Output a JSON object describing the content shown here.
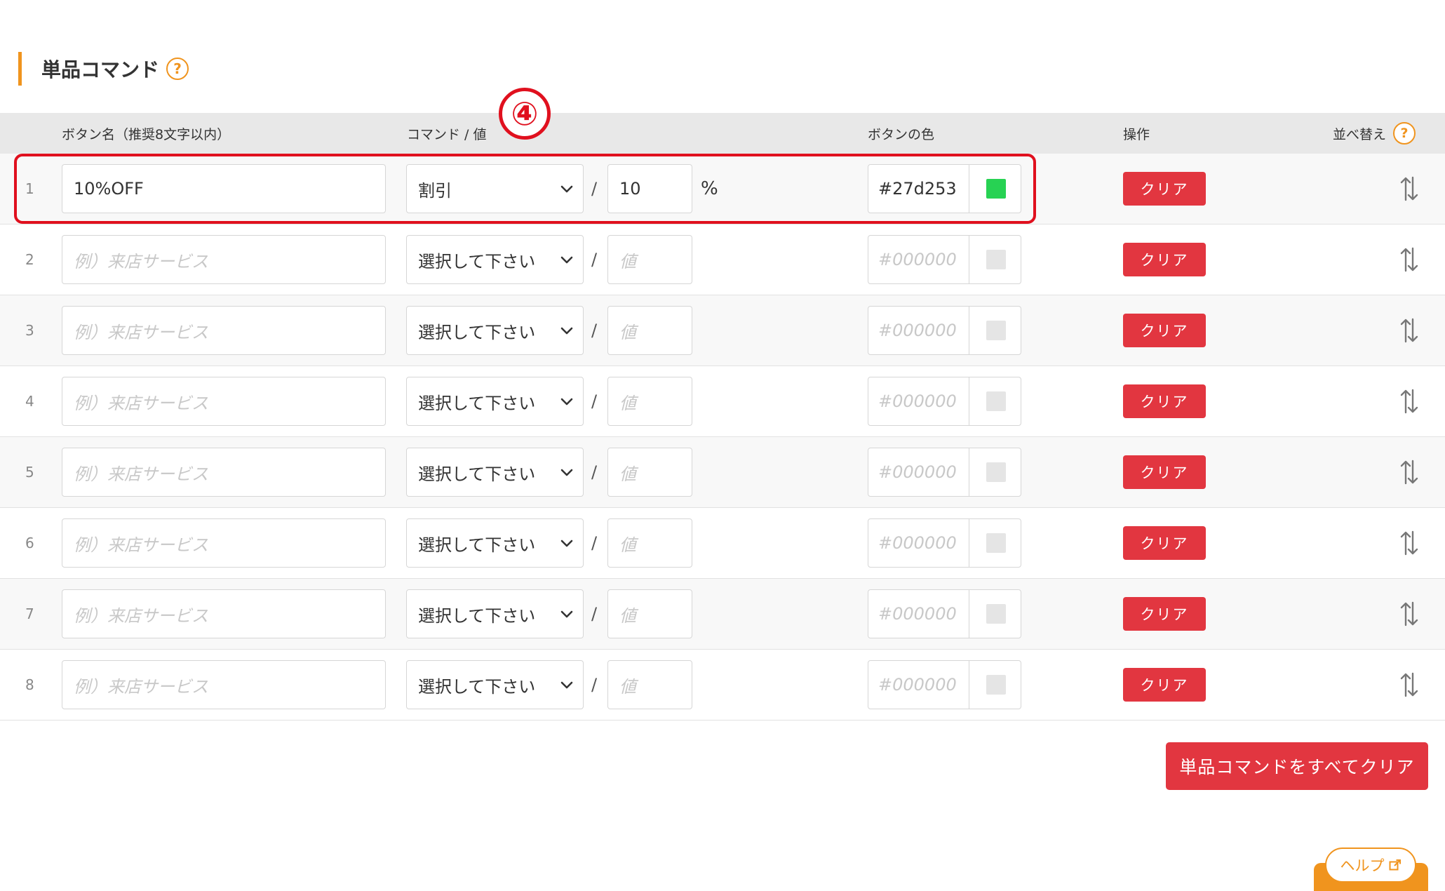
{
  "section": {
    "title": "単品コマンド",
    "help_glyph": "?"
  },
  "table": {
    "headers": {
      "button_name": "ボタン名（推奨8文字以内）",
      "command_value": "コマンド / 値",
      "button_color": "ボタンの色",
      "operation": "操作",
      "sort": "並べ替え"
    },
    "rows": [
      {
        "num": "1",
        "name": "10%OFF",
        "command": "割引",
        "value": "10",
        "unit": "%",
        "color": "#27d253",
        "swatch": "#27d253",
        "clear": "クリア",
        "filled": true
      },
      {
        "num": "2",
        "name_placeholder": "例）来店サービス",
        "command": "選択して下さい",
        "value_placeholder": "値",
        "color_placeholder": "#000000",
        "swatch": "#e5e5e5",
        "clear": "クリア"
      },
      {
        "num": "3",
        "name_placeholder": "例）来店サービス",
        "command": "選択して下さい",
        "value_placeholder": "値",
        "color_placeholder": "#000000",
        "swatch": "#e5e5e5",
        "clear": "クリア"
      },
      {
        "num": "4",
        "name_placeholder": "例）来店サービス",
        "command": "選択して下さい",
        "value_placeholder": "値",
        "color_placeholder": "#000000",
        "swatch": "#e5e5e5",
        "clear": "クリア"
      },
      {
        "num": "5",
        "name_placeholder": "例）来店サービス",
        "command": "選択して下さい",
        "value_placeholder": "値",
        "color_placeholder": "#000000",
        "swatch": "#e5e5e5",
        "clear": "クリア"
      },
      {
        "num": "6",
        "name_placeholder": "例）来店サービス",
        "command": "選択して下さい",
        "value_placeholder": "値",
        "color_placeholder": "#000000",
        "swatch": "#e5e5e5",
        "clear": "クリア"
      },
      {
        "num": "7",
        "name_placeholder": "例）来店サービス",
        "command": "選択して下さい",
        "value_placeholder": "値",
        "color_placeholder": "#000000",
        "swatch": "#e5e5e5",
        "clear": "クリア"
      },
      {
        "num": "8",
        "name_placeholder": "例）来店サービス",
        "command": "選択して下さい",
        "value_placeholder": "値",
        "color_placeholder": "#000000",
        "swatch": "#e5e5e5",
        "clear": "クリア"
      }
    ]
  },
  "annotation": {
    "step_marker": "④",
    "highlight_color": "#e0101e"
  },
  "actions": {
    "clear_all": "単品コマンドをすべてクリア"
  },
  "help_tab": {
    "label": "ヘルプ",
    "icon": "external-link-icon"
  },
  "colors": {
    "accent": "#f0941e",
    "danger": "#e23640"
  }
}
